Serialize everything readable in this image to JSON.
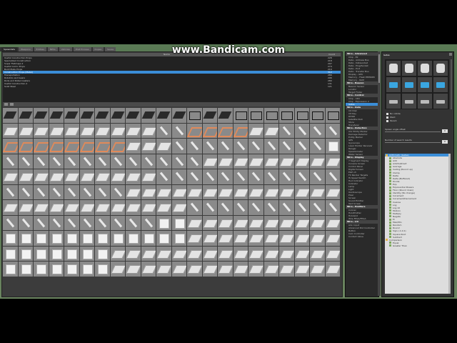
{
  "watermark": "www.Bandicam.com",
  "top_tabs": [
    "Spawnlists",
    "Weapons",
    "Entities",
    "NPCs",
    "Vehicles",
    "Post Process",
    "Dupes",
    "Saves"
  ],
  "prop_list": {
    "col_name": "Name",
    "col_count": "Count",
    "rows": [
      {
        "name": "Useful Construction Props",
        "count": "228"
      },
      {
        "name": "Specialized Construction",
        "count": "218"
      },
      {
        "name": "Super Flatmaps 2",
        "count": "297"
      },
      {
        "name": "Useful Comic Props",
        "count": "274"
      },
      {
        "name": "Build Plate Props",
        "count": "219"
      },
      {
        "name": "Construction Props (Metal)",
        "count": "312",
        "selected": true
      },
      {
        "name": "Transportation",
        "count": "289"
      },
      {
        "name": "Robotics and Gears",
        "count": "296"
      },
      {
        "name": "Rods and Rollercoasters",
        "count": "280"
      },
      {
        "name": "Useful Construction 2",
        "count": "131"
      },
      {
        "name": "Solid Steel",
        "count": "121"
      }
    ]
  },
  "prop_grid": {
    "cells": [
      "dark",
      "dark",
      "dark",
      "dark",
      "dark",
      "dark",
      "dark",
      "dark",
      "dark",
      "dark",
      "dark",
      "dark",
      "frame",
      "dark",
      "dark",
      "frame",
      "frame",
      "frame",
      "frame",
      "frame",
      "frame",
      "frame",
      "plate",
      "plate",
      "plate",
      "plate",
      "plate",
      "plate",
      "plate",
      "plate",
      "plate",
      "plate",
      "rod",
      "rod",
      "orange",
      "orange",
      "orange",
      "orange",
      "plate",
      "plate",
      "rod",
      "rod",
      "rod",
      "rod",
      "orange",
      "orange",
      "orange",
      "orange",
      "orange",
      "orange",
      "orange",
      "orange",
      "plate",
      "plate",
      "plate",
      "rod",
      "rod",
      "rod",
      "rod",
      "rod",
      "rod",
      "rod",
      "rod",
      "rod",
      "rod",
      "cube",
      "rod",
      "rod",
      "rod",
      "rod",
      "rod",
      "rod",
      "rod",
      "rod",
      "rod",
      "rod",
      "rod",
      "rod",
      "rod",
      "plate",
      "plate",
      "plate",
      "plate",
      "plate",
      "plate",
      "plate",
      "plate",
      "plate",
      "plate",
      "plate",
      "plate",
      "plate",
      "plate",
      "plate",
      "plate",
      "plate",
      "plate",
      "plate",
      "rod",
      "rod",
      "rod",
      "rod",
      "rod",
      "rod",
      "rod",
      "rod",
      "rod",
      "rod",
      "rod",
      "rod",
      "rod",
      "rod",
      "rod",
      "rod",
      "rod",
      "rod",
      "rod",
      "rod",
      "plate",
      "plate",
      "plate",
      "plate",
      "plate",
      "plate",
      "plate",
      "plate",
      "plate",
      "plate",
      "plate",
      "plate",
      "plate",
      "plate",
      "plate",
      "plate",
      "plate",
      "plate",
      "plate",
      "plate",
      "plate",
      "plate",
      "plate",
      "plate",
      "plate",
      "plate",
      "rod",
      "rod",
      "rod",
      "rod",
      "rod",
      "rod",
      "rod",
      "rod",
      "rod",
      "rod",
      "rod",
      "rod",
      "rod",
      "rod",
      "rod",
      "rod",
      "rod",
      "rod",
      "rod",
      "rod",
      "cube",
      "cube",
      "plate",
      "plate",
      "plate",
      "plate",
      "plate",
      "plate",
      "plate",
      "plate",
      "plate",
      "plate",
      "cube",
      "cube",
      "cube",
      "cube",
      "cube",
      "cube",
      "cube",
      "cube",
      "cube",
      "cube",
      "cube",
      "cube",
      "plate",
      "plate",
      "plate",
      "plate",
      "plate",
      "plate",
      "plate",
      "plate",
      "plate",
      "plate",
      "cube",
      "cube",
      "cube",
      "cube",
      "cube",
      "cube",
      "cube",
      "plate",
      "plate",
      "plate",
      "plate",
      "plate",
      "plate",
      "plate",
      "plate",
      "plate",
      "plate",
      "plate",
      "plate",
      "plate",
      "plate",
      "plate",
      "cube",
      "cube",
      "cube",
      "cube",
      "cube",
      "cube",
      "cube",
      "plate",
      "plate",
      "plate",
      "plate",
      "plate",
      "plate",
      "plate",
      "plate",
      "plate",
      "plate",
      "plate",
      "plate",
      "plate",
      "plate",
      "plate"
    ]
  },
  "wire_list": [
    {
      "type": "cat",
      "label": "Wire - Advanced"
    },
    {
      "type": "item",
      "label": "Chip - E2"
    },
    {
      "type": "item",
      "label": "Data - Address Bus"
    },
    {
      "type": "item",
      "label": "Data - Datasocket"
    },
    {
      "type": "item",
      "label": "Data - Plug/Socket"
    },
    {
      "type": "item",
      "label": "Data - Port"
    },
    {
      "type": "item",
      "label": "Data - Transfer Bus"
    },
    {
      "type": "item",
      "label": "Display - GPU"
    },
    {
      "type": "item",
      "label": "Memory - Flash EEPROM"
    },
    {
      "type": "item",
      "label": "Memory - RAM"
    },
    {
      "type": "cat",
      "label": "Wire - Beacon"
    },
    {
      "type": "item",
      "label": "Beacon Sensor"
    },
    {
      "type": "item",
      "label": "Locator"
    },
    {
      "type": "item",
      "label": "Target Finder"
    },
    {
      "type": "cat",
      "label": "Wire - Control"
    },
    {
      "type": "item",
      "label": "Chip - CPU"
    },
    {
      "type": "item",
      "label": "Chip - Expression 2"
    },
    {
      "type": "item",
      "label": "Gates",
      "selected": true
    },
    {
      "type": "cat",
      "label": "Wire - Data"
    },
    {
      "type": "item",
      "label": "CD Disk"
    },
    {
      "type": "item",
      "label": "CD Ray"
    },
    {
      "type": "item",
      "label": "DHDD"
    },
    {
      "type": "item",
      "label": "Satellite Dish"
    },
    {
      "type": "item",
      "label": "Store"
    },
    {
      "type": "item",
      "label": "Transferer"
    },
    {
      "type": "cat",
      "label": "Wire - Detection"
    },
    {
      "type": "item",
      "label": "Adv Entity Marker"
    },
    {
      "type": "item",
      "label": "Damage Detector"
    },
    {
      "type": "item",
      "label": "Entity Marker"
    },
    {
      "type": "item",
      "label": "GPS"
    },
    {
      "type": "item",
      "label": "Gyroscope"
    },
    {
      "type": "item",
      "label": "Laser Pointer Receiver"
    },
    {
      "type": "item",
      "label": "Ranger"
    },
    {
      "type": "item",
      "label": "Speedometer"
    },
    {
      "type": "item",
      "label": "Water Sensor"
    },
    {
      "type": "cat",
      "label": "Wire - Display"
    },
    {
      "type": "item",
      "label": "7 Segment Display"
    },
    {
      "type": "item",
      "label": "Console Screen"
    },
    {
      "type": "item",
      "label": "Control Panel"
    },
    {
      "type": "item",
      "label": "Digital Screen"
    },
    {
      "type": "item",
      "label": "EGP v3"
    },
    {
      "type": "item",
      "label": "FX Render Targets"
    },
    {
      "type": "item",
      "label": "Hi-Speed Switch"
    },
    {
      "type": "item",
      "label": "Hud Indicator"
    },
    {
      "type": "item",
      "label": "Indicator"
    },
    {
      "type": "item",
      "label": "Lamp"
    },
    {
      "type": "item",
      "label": "Light"
    },
    {
      "type": "item",
      "label": "Oscilloscope"
    },
    {
      "type": "item",
      "label": "Pixel"
    },
    {
      "type": "item",
      "label": "Screen"
    },
    {
      "type": "item",
      "label": "Sound Emitter"
    },
    {
      "type": "item",
      "label": "Text Screen"
    },
    {
      "type": "cat",
      "label": "Wire - Emitters"
    },
    {
      "type": "item",
      "label": "Colorer"
    },
    {
      "type": "item",
      "label": "HoloEmitter"
    },
    {
      "type": "item",
      "label": "HoloGrid"
    },
    {
      "type": "item",
      "label": "Wire FPGA/FPGA"
    },
    {
      "type": "cat",
      "label": "Wire - I/O"
    },
    {
      "type": "item",
      "label": "Adv. Input"
    },
    {
      "type": "item",
      "label": "Advanced Pod Controller"
    },
    {
      "type": "item",
      "label": "Button"
    },
    {
      "type": "item",
      "label": "Cam Controller"
    },
    {
      "type": "item",
      "label": "Contact Value"
    }
  ],
  "right_panel": {
    "title": "Gates",
    "options": [
      "No collide",
      "Weld",
      "Parent"
    ],
    "slider1_label": "Spawn angle offset",
    "slider1_value": "0",
    "slider2_label": "Number of search results",
    "slider2_value": "0",
    "gate_icons": [
      "round",
      "round",
      "round",
      "round",
      "chip",
      "chip",
      "chip",
      "chip",
      "flat",
      "flat",
      "flat",
      "flat"
    ],
    "tree": [
      {
        "kind": "folder",
        "label": "Arithmetic (Gates)",
        "selected": true
      },
      {
        "kind": "leaf",
        "label": "Absolute"
      },
      {
        "kind": "leaf",
        "label": "Add"
      },
      {
        "kind": "leaf",
        "label": "Add/Subtract"
      },
      {
        "kind": "leaf",
        "label": "Average"
      },
      {
        "kind": "leaf",
        "label": "Ceiling (Round up)"
      },
      {
        "kind": "leaf",
        "label": "Clamp"
      },
      {
        "kind": "leaf",
        "label": "Delta"
      },
      {
        "kind": "leaf",
        "label": "Delta (Buffered)"
      },
      {
        "kind": "leaf",
        "label": "Divide"
      },
      {
        "kind": "leaf",
        "label": "Exp"
      },
      {
        "kind": "leaf",
        "label": "Exponential Powers"
      },
      {
        "kind": "leaf",
        "label": "Floor (Round down)"
      },
      {
        "kind": "leaf",
        "label": "Identity (No change)"
      },
      {
        "kind": "leaf",
        "label": "Increment"
      },
      {
        "kind": "leaf",
        "label": "Increment/Decrement"
      },
      {
        "kind": "leaf",
        "label": "Inverse"
      },
      {
        "kind": "leaf",
        "label": "Log"
      },
      {
        "kind": "leaf",
        "label": "Log 10"
      },
      {
        "kind": "leaf",
        "label": "Modulo"
      },
      {
        "kind": "leaf",
        "label": "Multiply"
      },
      {
        "kind": "leaf",
        "label": "Negate"
      },
      {
        "kind": "leaf",
        "label": "Pi"
      },
      {
        "kind": "leaf",
        "label": "Max/Min"
      },
      {
        "kind": "leaf",
        "label": "Random"
      },
      {
        "kind": "leaf",
        "label": "Round"
      },
      {
        "kind": "leaf",
        "label": "Sign (-1,0,1)"
      },
      {
        "kind": "leaf",
        "label": "Square Root"
      },
      {
        "kind": "leaf",
        "label": "Subtract"
      },
      {
        "kind": "folder",
        "label": "Comparison"
      },
      {
        "kind": "leaf",
        "label": "Equal"
      },
      {
        "kind": "leaf",
        "label": "Greater Than"
      }
    ]
  }
}
